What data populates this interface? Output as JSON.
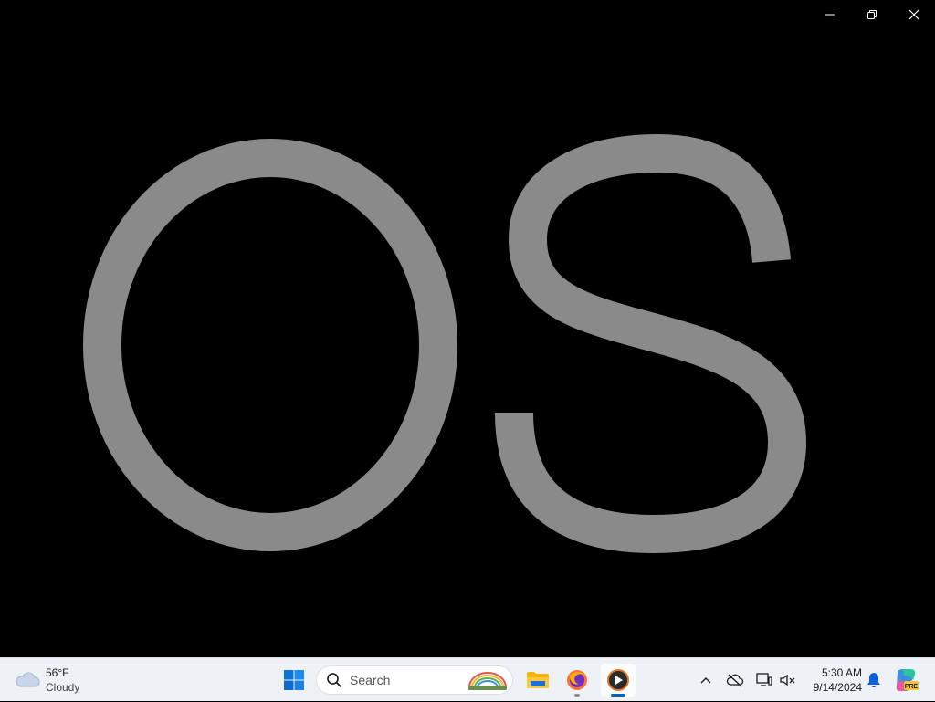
{
  "window": {
    "display_text": "OS",
    "text_color": "#8a8a8a",
    "background": "#000000",
    "caption_buttons": [
      "minimize-icon",
      "restore-icon",
      "close-icon"
    ]
  },
  "taskbar": {
    "weather": {
      "temperature": "56°F",
      "condition": "Cloudy",
      "icon": "cloud-icon"
    },
    "start_icon": "windows-start-icon",
    "search": {
      "placeholder": "Search",
      "icon": "search-icon"
    },
    "apps": [
      {
        "name": "File Explorer",
        "icon": "folder-icon",
        "running": false
      },
      {
        "name": "Firefox",
        "icon": "firefox-icon",
        "running": true
      },
      {
        "name": "Media Player",
        "icon": "media-player-icon",
        "running": true,
        "active": true
      }
    ],
    "tray": {
      "icons": [
        "chevron-up-icon",
        "cloud-offline-icon",
        "display-icon",
        "speaker-muted-icon"
      ]
    },
    "clock": {
      "time": "5:30 AM",
      "date": "9/14/2024"
    },
    "notification_icon": "bell-icon",
    "copilot_badge": "PRE",
    "accent_color": "#0067c0"
  }
}
